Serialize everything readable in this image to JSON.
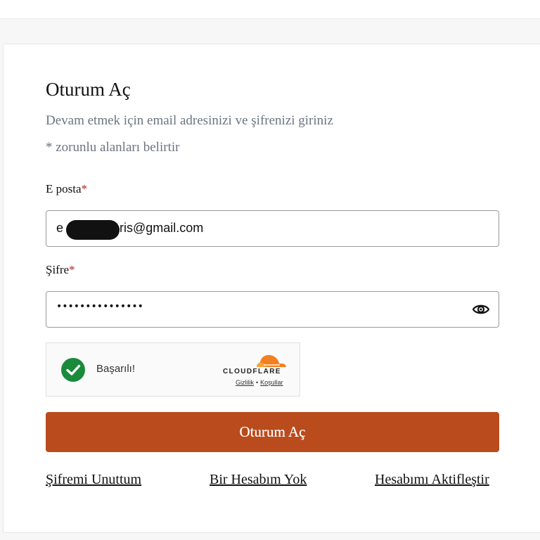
{
  "header": {
    "title": "Oturum Aç",
    "subtitle": "Devam etmek için email adresinizi ve şifrenizi giriniz",
    "required_note": "* zorunlu alanları belirtir"
  },
  "form": {
    "email_label": "E posta",
    "password_label": "Şifre",
    "required_mark": "*",
    "email_value_start": "e",
    "email_value_end": "ris@gmail.com",
    "password_value": "•••••••••••••••",
    "show_password_icon": "eye-icon",
    "submit_label": "Oturum Aç"
  },
  "captcha": {
    "status_icon": "check-circle-icon",
    "status": "Başarılı!",
    "brand": "CLOUDFLARE",
    "privacy_link": "Gizlilik",
    "separator": "•",
    "terms_link": "Koşullar"
  },
  "links": {
    "forgot_password": "Şifremi Unuttum",
    "no_account": "Bir Hesabım Yok",
    "activate_account": "Hesabımı Aktifleştir"
  },
  "colors": {
    "accent": "#b94b1c",
    "required": "#b0241b",
    "success": "#1a8a3c",
    "cloudflare": "#f38020"
  }
}
